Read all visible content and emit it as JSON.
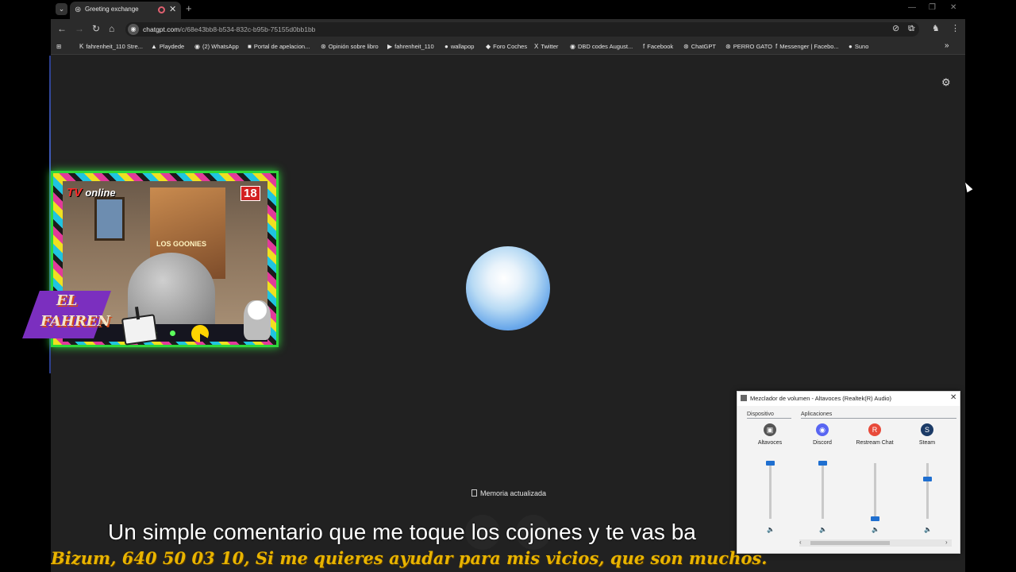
{
  "browser": {
    "tab": {
      "title": "Greeting exchange",
      "close": "✕"
    },
    "new_tab": "+",
    "window_controls": {
      "minimize": "—",
      "restore": "❐",
      "close": "✕"
    },
    "url": {
      "host": "chatgpt.com",
      "path": "/c/68e43bb8-b534-832c-b95b-75155d0bb1bb"
    },
    "bookmarks": [
      {
        "label": "fahrenheit_110 Stre...",
        "icon": "K"
      },
      {
        "label": "Playdede",
        "icon": "▲"
      },
      {
        "label": "(2) WhatsApp",
        "icon": "◉"
      },
      {
        "label": "Portal de apelacion...",
        "icon": "■"
      },
      {
        "label": "Opinión sobre libro",
        "icon": "⊛"
      },
      {
        "label": "fahrenheit_110",
        "icon": "▶"
      },
      {
        "label": "wallapop",
        "icon": "●"
      },
      {
        "label": "Foro Coches",
        "icon": "◆"
      },
      {
        "label": "Twitter",
        "icon": "X"
      },
      {
        "label": "DBD codes August...",
        "icon": "◉"
      },
      {
        "label": "Facebook",
        "icon": "f"
      },
      {
        "label": "ChatGPT",
        "icon": "⊛"
      },
      {
        "label": "PERRO GATO",
        "icon": "⊛"
      },
      {
        "label": "Messenger | Facebo...",
        "icon": "f"
      },
      {
        "label": "Suno",
        "icon": "●"
      }
    ],
    "bookmarks_more": "»"
  },
  "chat": {
    "memory_status": "Memoria actualizada"
  },
  "webcam": {
    "label_main": "TV",
    "label_sub": "online",
    "age_badge": "18",
    "poster_text": "LOS GOONIES",
    "logo_line1": "EL",
    "logo_line2": "FAHREN"
  },
  "mixer": {
    "title": "Mezclador de volumen - Altavoces (Realtek(R) Audio)",
    "close": "✕",
    "device_section": "Dispositivo",
    "apps_section": "Aplicaciones",
    "channels": [
      {
        "name": "Altavoces",
        "icon": "speaker-device-icon",
        "glyph": "▣",
        "color": "#555555",
        "level": 1.0
      },
      {
        "name": "Discord",
        "icon": "discord-icon",
        "glyph": "◉",
        "color": "#5865F2",
        "level": 1.0
      },
      {
        "name": "Restream Chat",
        "icon": "restream-icon",
        "glyph": "R",
        "color": "#e84a3a",
        "level": 0.0
      },
      {
        "name": "Steam",
        "icon": "steam-icon",
        "glyph": "S",
        "color": "#1b3a66",
        "level": 0.72
      }
    ]
  },
  "captions": {
    "subtitle": "Un simple comentario que me toque los cojones y te vas ba",
    "ticker": "Bizum, 640 50 03 10,  Si me quieres ayudar para mis vicios, que son muchos."
  },
  "colors": {
    "page_bg": "#212121",
    "webcam_border": "#2ed63a",
    "ticker": "#e8b400",
    "mixer_accent": "#1f6fd0"
  }
}
